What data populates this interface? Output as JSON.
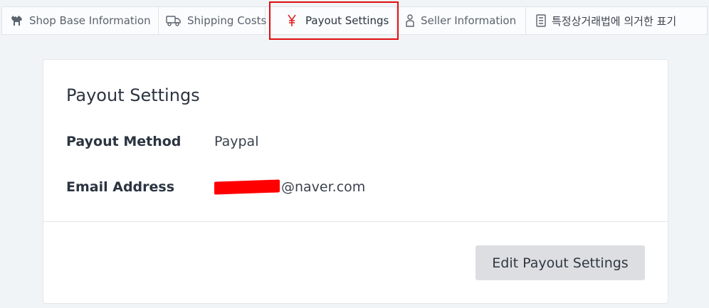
{
  "tabs": [
    {
      "label": "Shop Base Information",
      "icon": "camel-icon"
    },
    {
      "label": "Shipping Costs",
      "icon": "truck-icon"
    },
    {
      "label": "Payout Settings",
      "icon": "yen-icon",
      "active": true
    },
    {
      "label": "Seller Information",
      "icon": "person-icon"
    },
    {
      "label": "특정상거래법에 의거한 표기",
      "icon": "document-icon"
    }
  ],
  "payout": {
    "title": "Payout Settings",
    "method_label": "Payout Method",
    "method_value": "Paypal",
    "email_label": "Email Address",
    "email_value": "@naver.com"
  },
  "actions": {
    "edit_label": "Edit Payout Settings"
  },
  "colors": {
    "accent": "#e02424",
    "highlight_outline": "#e00d0d",
    "redaction": "#ff0000",
    "button_bg": "#dcdee1",
    "page_bg": "#f1f4f7"
  }
}
